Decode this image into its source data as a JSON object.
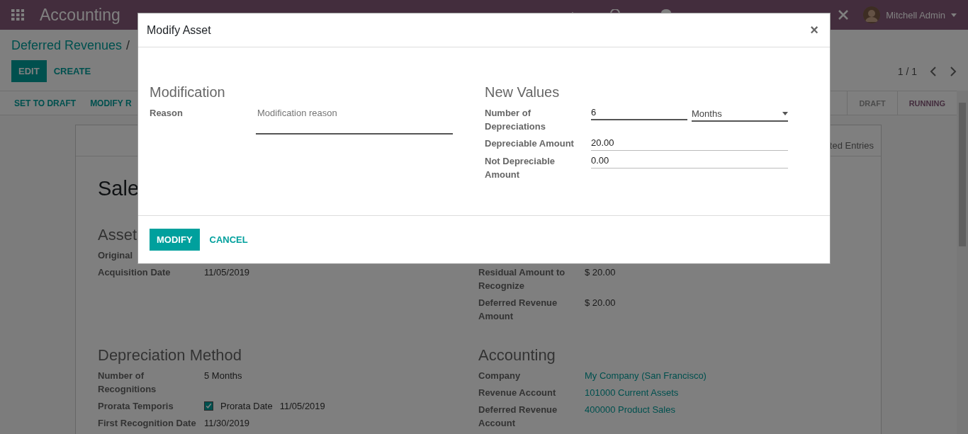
{
  "navbar": {
    "app_name": "Accounting",
    "user": "Mitchell Admin"
  },
  "breadcrumb": {
    "parent": "Deferred Revenues",
    "separator": "/"
  },
  "buttons": [
    {
      "label": "EDIT",
      "kind": "primary"
    },
    {
      "label": "CREATE",
      "kind": "link"
    }
  ],
  "pager": "1 / 1",
  "statusbar": {
    "actions": [
      "SET TO DRAFT",
      "MODIFY R"
    ],
    "stages": [
      {
        "label": "DRAFT",
        "selected": false
      },
      {
        "label": "RUNNING",
        "selected": true
      }
    ]
  },
  "sheet": {
    "tab": "ted Entries",
    "title": "Sale",
    "sections": [
      {
        "heading": "Asset",
        "fields": [
          {
            "label": "Original",
            "kind": "text"
          },
          {
            "label": "Acquisition Date",
            "kind": "text",
            "value": "11/05/2019"
          }
        ]
      },
      {
        "fields": [
          {
            "label": "Residual Amount to Recognize",
            "kind": "text",
            "value": "$ 20.00"
          },
          {
            "label": "Deferred Revenue Amount",
            "kind": "text",
            "value": "$ 20.00"
          }
        ]
      },
      {
        "heading": "Depreciation Method",
        "fields": [
          {
            "label": "Number of Recognitions",
            "kind": "text",
            "value": "5  Months"
          },
          {
            "label": "Prorata Temporis",
            "kind": "checkbox",
            "checked": true,
            "value": "Prorata Date",
            "extra": "11/05/2019"
          },
          {
            "label": "First Recognition Date",
            "kind": "text",
            "value": "11/30/2019"
          }
        ]
      },
      {
        "heading": "Accounting",
        "fields": [
          {
            "label": "Company",
            "kind": "link",
            "value": "My Company (San Francisco)"
          },
          {
            "label": "Revenue Account",
            "kind": "link",
            "value": "101000 Current Assets"
          },
          {
            "label": "Deferred Revenue Account",
            "kind": "link",
            "value": "400000 Product Sales"
          }
        ]
      }
    ]
  },
  "modal": {
    "title": "Modify Asset",
    "close": "×",
    "columns": [
      {
        "heading": "Modification",
        "fields": [
          {
            "label": "Reason",
            "kind": "textarea",
            "placeholder": "Modification reason"
          }
        ]
      },
      {
        "heading": "New Values",
        "fields": [
          {
            "label": "Number of Depreciations",
            "kind": "number_unit",
            "value": "6",
            "unit": "Months"
          },
          {
            "label": "Depreciable Amount",
            "kind": "input",
            "value": "20.00"
          },
          {
            "label": "Not Depreciable Amount",
            "kind": "input",
            "value": "0.00"
          }
        ]
      }
    ],
    "buttons": [
      {
        "label": "MODIFY",
        "kind": "primary"
      },
      {
        "label": "CANCEL",
        "kind": "link"
      }
    ]
  }
}
